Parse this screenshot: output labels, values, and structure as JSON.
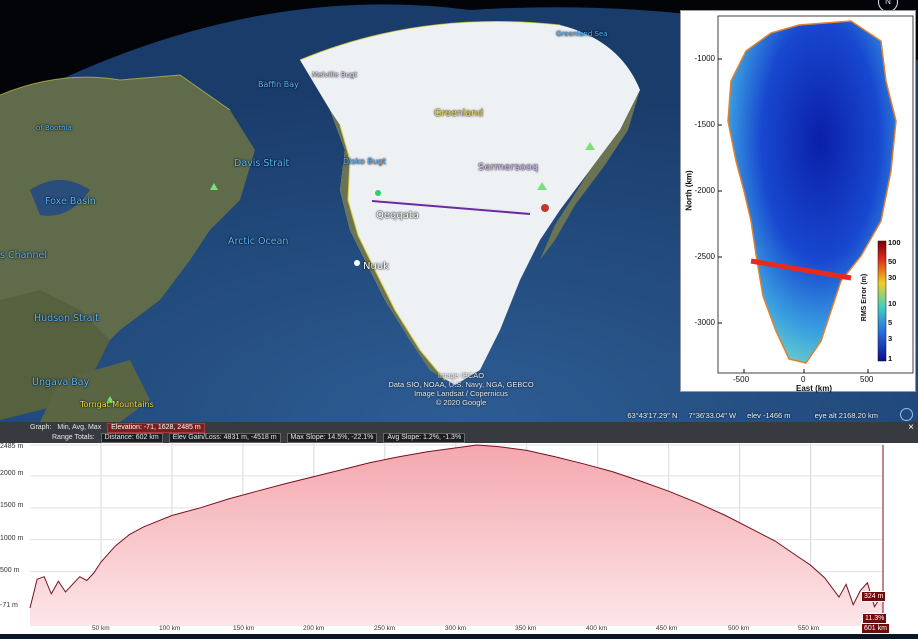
{
  "map": {
    "labels": {
      "greenland": "Greenland",
      "sermersooq": "Sermersooq",
      "qeqqata": "Qeqqata",
      "nuuk": "Nuuk",
      "baffin_bay": "Baffin Bay",
      "davis_strait": "Davis Strait",
      "foxe_basin": "Foxe Basin",
      "arctic_ocean": "Arctic Ocean",
      "hudson_strait": "Hudson Strait",
      "ungava_bay": "Ungava Bay",
      "torngat_mountains": "Torngat Mountains",
      "disko_bugt": "Disko Bugt",
      "melville_bugt": "Melville Bugt",
      "greenland_sea": "Greenland Sea",
      "channel": "s Channel",
      "basin_partial": "of Boothia"
    },
    "attribution": [
      "Image IBCAO",
      "Data SIO, NOAA, U.S. Navy, NGA, GEBCO",
      "Image Landsat / Copernicus",
      "© 2020 Google"
    ],
    "status": {
      "lat": "63°43'17.29\" N",
      "lon": "7°36'33.04\" W",
      "elev": "elev -1466 m",
      "eye_alt": "eye alt 2168.20 km"
    },
    "compass_letter": "N"
  },
  "inset": {
    "yticks": [
      "-1000",
      "-1500",
      "-2000",
      "-2500",
      "-3000"
    ],
    "xticks": [
      "-500",
      "0",
      "500"
    ],
    "ylabel": "North (km)",
    "xlabel": "East (km)",
    "colorbar_label": "RMS Error (m)",
    "colorbar_ticks": [
      "100",
      "50",
      "30",
      "10",
      "5",
      "3",
      "1"
    ],
    "colors": {
      "low": "#0a1aa0",
      "mid": "#2fa0e8",
      "high": "#c8281c",
      "line": "#e82a1e"
    }
  },
  "profile": {
    "header": {
      "graph_label": "Graph:",
      "graph_opts": "Min, Avg, Max",
      "elevation": "Elevation: -71, 1628, 2485 m",
      "range_label": "Range Totals:",
      "distance": "Distance: 602 km",
      "gain_loss": "Elev Gain/Loss: 4831 m, -4518 m",
      "max_slope": "Max Slope: 14.5%, -22.1%",
      "avg_slope": "Avg Slope: 1.2%, -1.3%",
      "close": "×"
    },
    "y_labels": [
      "2485 m",
      "2000 m",
      "1500 m",
      "1000 m",
      "500 m",
      "-71 m"
    ],
    "x_labels": [
      "50 km",
      "100 km",
      "150 km",
      "200 km",
      "250 km",
      "300 km",
      "350 km",
      "400 km",
      "450 km",
      "500 km",
      "550 km",
      "601 km"
    ],
    "marker": {
      "elevation": "324 m",
      "slope": "11.3%"
    },
    "colors": {
      "line": "#7a1020",
      "fill_top": "#f3a7ae",
      "fill_bottom": "#fde6e8"
    },
    "elevation_series_km": [
      0,
      5,
      10,
      15,
      20,
      25,
      30,
      35,
      40,
      45,
      50,
      60,
      70,
      80,
      90,
      100,
      120,
      140,
      160,
      180,
      200,
      220,
      240,
      260,
      280,
      300,
      315,
      330,
      350,
      370,
      390,
      410,
      430,
      450,
      470,
      490,
      510,
      525,
      540,
      550,
      560,
      570,
      575,
      580,
      585,
      590,
      595,
      601
    ],
    "elevation_series_m": [
      -71,
      380,
      420,
      150,
      350,
      180,
      300,
      420,
      360,
      480,
      650,
      900,
      1080,
      1200,
      1290,
      1380,
      1500,
      1640,
      1760,
      1880,
      1990,
      2100,
      2210,
      2300,
      2380,
      2440,
      2485,
      2460,
      2400,
      2300,
      2190,
      2070,
      1920,
      1760,
      1580,
      1380,
      1150,
      980,
      750,
      600,
      400,
      100,
      300,
      -20,
      200,
      324,
      -50,
      150
    ]
  }
}
